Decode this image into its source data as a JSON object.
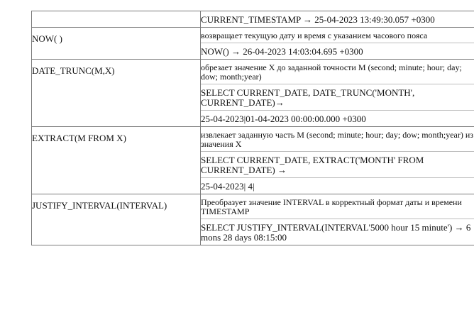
{
  "rows": [
    {
      "function": "",
      "lines": [
        "CURRENT_TIMESTAMP → 25-04-2023 13:49:30.057 +0300"
      ]
    },
    {
      "function": "NOW( )",
      "lines": [
        "возвращает текущую дату и время с указанием часового пояса",
        "NOW() → 26-04-2023 14:03:04.695 +0300"
      ]
    },
    {
      "function": "DATE_TRUNC(M,X)",
      "lines": [
        "обрезает значение X до заданной точности M (second; minute; hour; day; dow; month;year)",
        "SELECT CURRENT_DATE, DATE_TRUNC('MONTH', CURRENT_DATE)→",
        "25-04-2023|01-04-2023 00:00:00.000 +0300"
      ]
    },
    {
      "function": "EXTRACT(M FROM X)",
      "lines": [
        "извлекает заданную часть M (second; minute; hour; day; dow; month;year) из значения X",
        "SELECT CURRENT_DATE, EXTRACT('MONTH' FROM CURRENT_DATE) →",
        "25-04-2023| 4|"
      ]
    },
    {
      "function": "JUSTIFY_INTERVAL(INTERVAL)",
      "lines": [
        "Преобразует значение INTERVAL в корректный формат даты и времени TIMESTAMP",
        "SELECT JUSTIFY_INTERVAL(INTERVAL'5000 hour 15 minute') → 6 mons 28 days 08:15:00"
      ]
    }
  ]
}
